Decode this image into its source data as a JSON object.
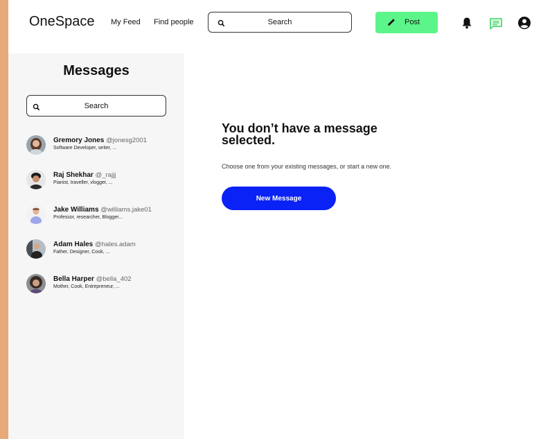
{
  "header": {
    "logo": "OneSpace",
    "nav": [
      "My Feed",
      "Find people"
    ],
    "search_placeholder": "Search",
    "post_label": "Post",
    "icons": [
      "bell-icon",
      "chat-icon",
      "account-icon"
    ],
    "post_color": "#5cf58a",
    "chat_icon_color": "#47d86d"
  },
  "sidebar": {
    "title": "Messages",
    "search_placeholder": "Search",
    "contacts": [
      {
        "name": "Gremory Jones",
        "handle": "@jonesg2001",
        "bio": "Software Developer, writer, ..."
      },
      {
        "name": "Raj Shekhar",
        "handle": "@_rajjj",
        "bio": "Pianist, traveller, vlogger, ..."
      },
      {
        "name": "Jake Williams",
        "handle": "@williams.jake01",
        "bio": "Professor, researcher, Blogger..."
      },
      {
        "name": "Adam Hales",
        "handle": "@hales.adam",
        "bio": "Father, Designer, Cook, ..."
      },
      {
        "name": "Bella Harper",
        "handle": "@bella_402",
        "bio": "Mother, Cook, Entrepreneur, ..."
      }
    ]
  },
  "main": {
    "title_line1": "You don’t have a message",
    "title_line2": "selected.",
    "subtitle": "Choose one from your existing messages, or start a new one.",
    "new_message_label": "New Message",
    "accent_color": "#0a22f5"
  }
}
